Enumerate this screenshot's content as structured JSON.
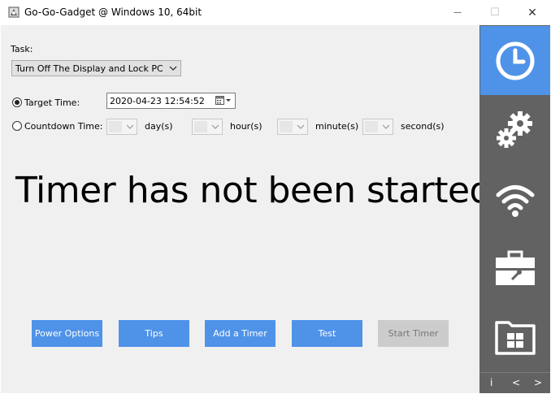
{
  "window": {
    "title": "Go-Go-Gadget @ Windows 10, 64bit",
    "minimize_glyph": "—",
    "maximize_glyph": "☐",
    "close_glyph": "✕"
  },
  "task": {
    "label": "Task:",
    "selected": "Turn Off The Display and Lock PC"
  },
  "target_time": {
    "label": "Target Time:",
    "selected": true,
    "value": "2020-04-23 12:54:52"
  },
  "countdown": {
    "label": "Countdown Time:",
    "selected": false,
    "units": [
      "day(s)",
      "hour(s)",
      "minute(s)",
      "second(s)"
    ]
  },
  "status": {
    "message": "Timer has not been started"
  },
  "buttons": {
    "power_options": "Power Options",
    "tips": "Tips",
    "add_timer": "Add a Timer",
    "test": "Test",
    "start_timer": "Start Timer"
  },
  "sidebar": {
    "items": [
      "clock-icon",
      "gears-icon",
      "wifi-icon",
      "toolbox-icon",
      "windows-folder-icon"
    ],
    "active": "clock-icon",
    "footer": {
      "info": "i",
      "prev": "<",
      "next": ">"
    }
  },
  "colors": {
    "accent": "#4f93e8",
    "sidebar": "#626262",
    "panel": "#f0f0f0",
    "disabled": "#cccccc"
  }
}
